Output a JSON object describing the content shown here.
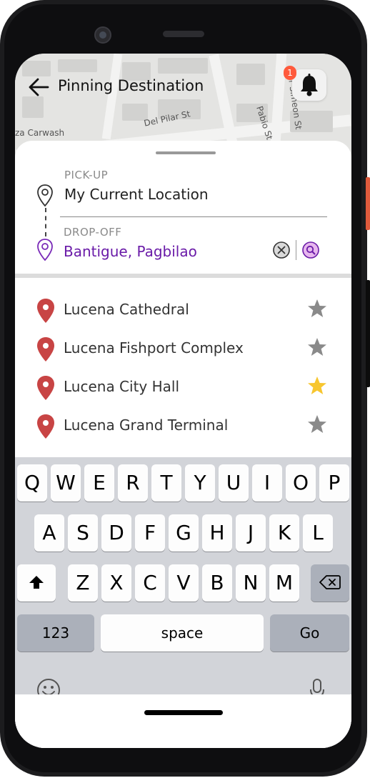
{
  "header": {
    "title": "Pinning Destination",
    "notification_count": "1"
  },
  "map": {
    "labels": {
      "del_pilar": "Del Pilar St",
      "pabio": "Pabio St",
      "simeon": "Dr Simeon St",
      "carwash": "za Carwash"
    }
  },
  "route": {
    "pickup_label": "PICK-UP",
    "pickup_value": "My Current Location",
    "dropoff_label": "DROP-OFF",
    "dropoff_value": "Bantigue, Pagbilao"
  },
  "places": [
    {
      "name": "Lucena Cathedral",
      "favorite": false
    },
    {
      "name": "Lucena Fishport Complex",
      "favorite": false
    },
    {
      "name": "Lucena City Hall",
      "favorite": true
    },
    {
      "name": "Lucena Grand Terminal",
      "favorite": false
    }
  ],
  "keyboard": {
    "row1": [
      "Q",
      "W",
      "E",
      "R",
      "T",
      "Y",
      "U",
      "I",
      "O",
      "P"
    ],
    "row2": [
      "A",
      "S",
      "D",
      "F",
      "G",
      "H",
      "J",
      "K",
      "L"
    ],
    "row3": [
      "Z",
      "X",
      "C",
      "V",
      "B",
      "N",
      "M"
    ],
    "numbers_label": "123",
    "space_label": "space",
    "go_label": "Go"
  },
  "colors": {
    "accent_purple": "#6a1ba8",
    "pin_red": "#c84444",
    "star_gold": "#f7c62f",
    "star_gray": "#8a8a8a",
    "badge": "#ff5a3c"
  },
  "icons": {
    "back": "arrow-left-icon",
    "bell": "bell-icon",
    "pickup": "location-pin-outline-icon",
    "dropoff": "location-pin-purple-icon",
    "clear": "clear-circle-icon",
    "search": "search-icon",
    "place": "map-pin-icon",
    "favorite": "star-icon",
    "shift": "shift-icon",
    "backspace": "backspace-icon",
    "emoji": "emoji-icon",
    "mic": "microphone-icon"
  }
}
